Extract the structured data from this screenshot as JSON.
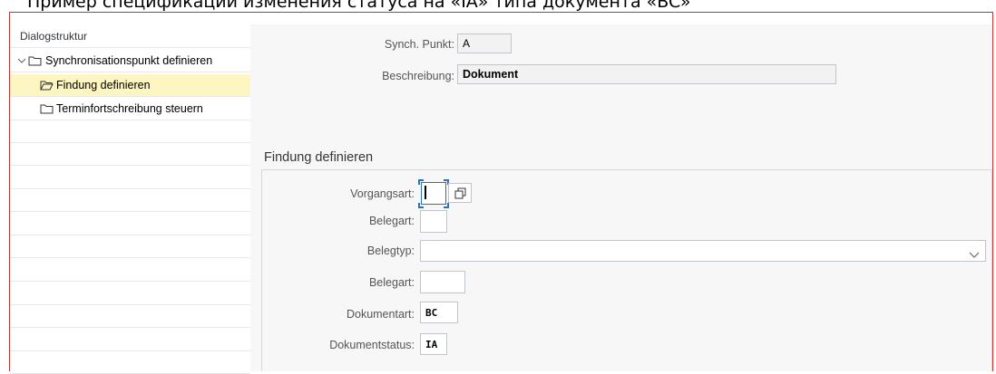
{
  "caption": "Пример спецификации изменения статуса на «IA» типа документа «BC»",
  "sidebar": {
    "title": "Dialogstruktur",
    "items": [
      {
        "label": "Synchronisationspunkt definieren",
        "icon": "folder-icon",
        "level": 0,
        "expanded": true
      },
      {
        "label": "Findung definieren",
        "icon": "folder-open-icon",
        "level": 1,
        "selected": true
      },
      {
        "label": "Terminfortschreibung steuern",
        "icon": "folder-icon",
        "level": 1
      }
    ]
  },
  "header_fields": {
    "sync_point": {
      "label": "Synch. Punkt:",
      "value": "A"
    },
    "description": {
      "label": "Beschreibung:",
      "value": "Dokument"
    }
  },
  "section": {
    "title": "Findung definieren",
    "fields": {
      "vorgangsart": {
        "label": "Vorgangsart:",
        "value": ""
      },
      "belegart1": {
        "label": "Belegart:",
        "value": ""
      },
      "belegtyp": {
        "label": "Belegtyp:",
        "value": ""
      },
      "belegart2": {
        "label": "Belegart:",
        "value": ""
      },
      "dokumentart": {
        "label": "Dokumentart:",
        "value": "BC"
      },
      "dokumentstatus": {
        "label": "Dokumentstatus:",
        "value": "IA"
      }
    }
  },
  "colors": {
    "selection": "#fdf6c3",
    "frame": "#c4332e",
    "focus": "#2e6fc4"
  }
}
